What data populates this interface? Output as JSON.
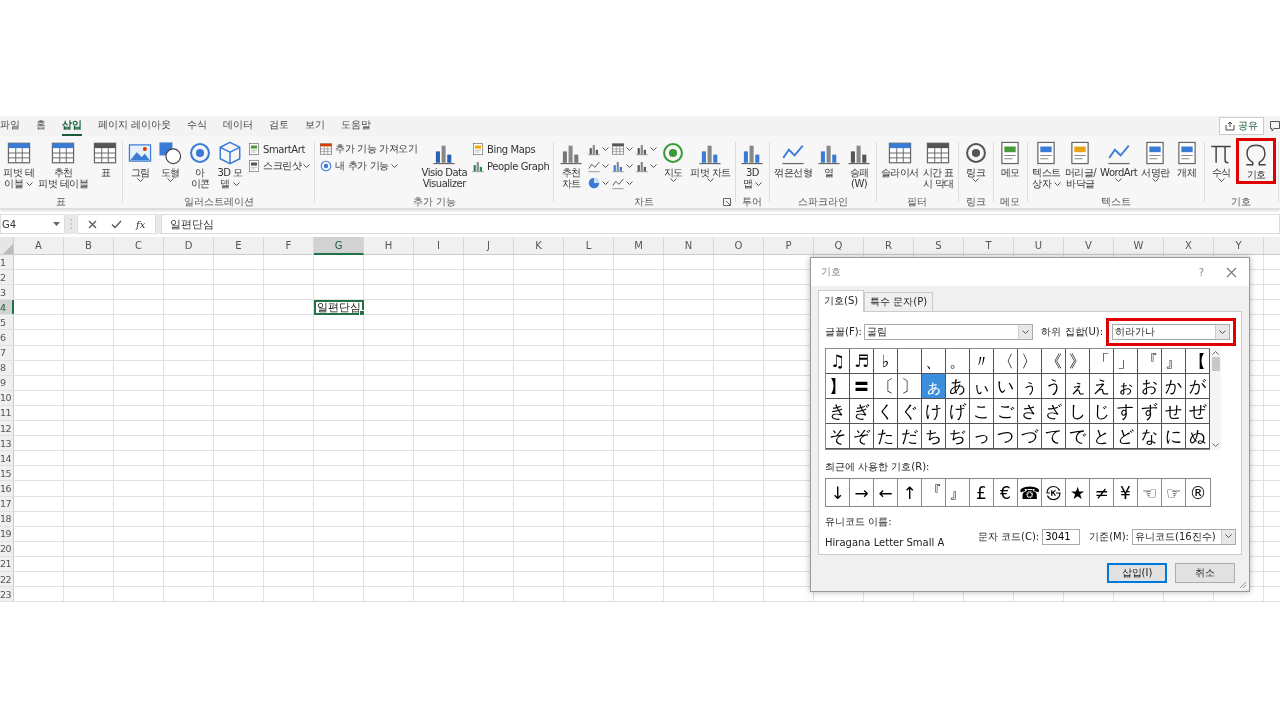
{
  "tabs": [
    {
      "label": "파일",
      "selected": false
    },
    {
      "label": "홈",
      "selected": false
    },
    {
      "label": "삽입",
      "selected": true
    },
    {
      "label": "페이지 레이아웃",
      "selected": false
    },
    {
      "label": "수식",
      "selected": false
    },
    {
      "label": "데이터",
      "selected": false
    },
    {
      "label": "검토",
      "selected": false
    },
    {
      "label": "보기",
      "selected": false
    },
    {
      "label": "도움말",
      "selected": false
    }
  ],
  "share_button": {
    "label": "공유"
  },
  "ribbon": {
    "groups": [
      {
        "label": "표",
        "launcher": false,
        "items": [
          {
            "kind": "large",
            "lines": [
              "피벗 테",
              "이블"
            ],
            "dropdown": true,
            "highlighted": false
          },
          {
            "kind": "large",
            "lines": [
              "추천",
              "피벗 테이블"
            ],
            "dropdown": false,
            "highlighted": false
          },
          {
            "kind": "large",
            "lines": [
              "표"
            ],
            "dropdown": false,
            "highlighted": false
          }
        ]
      },
      {
        "label": "일러스트레이션",
        "launcher": false,
        "items": [
          {
            "kind": "large",
            "lines": [
              "그림"
            ],
            "dropdown": true,
            "highlighted": false
          },
          {
            "kind": "large",
            "lines": [
              "도형"
            ],
            "dropdown": true,
            "highlighted": false
          },
          {
            "kind": "large",
            "lines": [
              "아",
              "이콘"
            ],
            "dropdown": false,
            "highlighted": false
          },
          {
            "kind": "large",
            "lines": [
              "3D 모",
              "델"
            ],
            "dropdown": true,
            "highlighted": false
          },
          {
            "kind": "stack",
            "items": [
              {
                "kind": "small",
                "label": "SmartArt",
                "dropdown": false
              },
              {
                "kind": "small",
                "label": "스크린샷",
                "dropdown": true
              }
            ]
          }
        ]
      },
      {
        "label": "추가 기능",
        "launcher": false,
        "items": [
          {
            "kind": "stack",
            "items": [
              {
                "kind": "small",
                "label": "추가 기능 가져오기",
                "dropdown": false
              },
              {
                "kind": "small",
                "label": "내 추가 기능",
                "dropdown": true
              }
            ]
          },
          {
            "kind": "large",
            "lines": [
              "Visio Data",
              "Visualizer"
            ],
            "dropdown": false,
            "highlighted": false
          },
          {
            "kind": "stack",
            "items": [
              {
                "kind": "small",
                "label": "Bing Maps",
                "dropdown": false
              },
              {
                "kind": "small",
                "label": "People Graph",
                "dropdown": false
              }
            ]
          }
        ]
      },
      {
        "label": "차트",
        "launcher": true,
        "items": [
          {
            "kind": "large",
            "lines": [
              "추천",
              "차트"
            ],
            "dropdown": false,
            "highlighted": false
          },
          {
            "kind": "stack",
            "items": [
              {
                "kind": "mini",
                "dropdown": true
              },
              {
                "kind": "mini",
                "dropdown": true
              },
              {
                "kind": "mini",
                "dropdown": true
              }
            ]
          },
          {
            "kind": "stack",
            "items": [
              {
                "kind": "mini",
                "dropdown": true
              },
              {
                "kind": "mini",
                "dropdown": true
              },
              {
                "kind": "mini",
                "dropdown": true
              }
            ]
          },
          {
            "kind": "stack",
            "items": [
              {
                "kind": "mini",
                "dropdown": true
              },
              {
                "kind": "mini",
                "dropdown": true
              }
            ]
          },
          {
            "kind": "large",
            "lines": [
              "지도"
            ],
            "dropdown": true,
            "highlighted": false
          },
          {
            "kind": "large",
            "lines": [
              "피벗 차트"
            ],
            "dropdown": true,
            "highlighted": false
          }
        ]
      },
      {
        "label": "투어",
        "launcher": false,
        "items": [
          {
            "kind": "large",
            "lines": [
              "3D",
              "맵"
            ],
            "dropdown": true,
            "highlighted": false
          }
        ]
      },
      {
        "label": "스파크라인",
        "launcher": false,
        "items": [
          {
            "kind": "large",
            "lines": [
              "꺾은선형"
            ],
            "dropdown": false,
            "highlighted": false
          },
          {
            "kind": "large",
            "lines": [
              "열"
            ],
            "dropdown": false,
            "highlighted": false
          },
          {
            "kind": "large",
            "lines": [
              "승패",
              "(W)"
            ],
            "dropdown": false,
            "highlighted": false
          }
        ]
      },
      {
        "label": "필터",
        "launcher": false,
        "items": [
          {
            "kind": "large",
            "lines": [
              "슬라이서"
            ],
            "dropdown": false,
            "highlighted": false
          },
          {
            "kind": "large",
            "lines": [
              "시간 표",
              "시 막대"
            ],
            "dropdown": false,
            "highlighted": false
          }
        ]
      },
      {
        "label": "링크",
        "launcher": false,
        "items": [
          {
            "kind": "large",
            "lines": [
              "링크"
            ],
            "dropdown": true,
            "highlighted": false
          }
        ]
      },
      {
        "label": "메모",
        "launcher": false,
        "items": [
          {
            "kind": "large",
            "lines": [
              "메모"
            ],
            "dropdown": false,
            "highlighted": false
          }
        ]
      },
      {
        "label": "텍스트",
        "launcher": false,
        "items": [
          {
            "kind": "large",
            "lines": [
              "텍스트",
              "상자"
            ],
            "dropdown": true,
            "highlighted": false
          },
          {
            "kind": "large",
            "lines": [
              "머리글/",
              "바닥글"
            ],
            "dropdown": false,
            "highlighted": false
          },
          {
            "kind": "large",
            "lines": [
              "WordArt"
            ],
            "dropdown": true,
            "highlighted": false
          },
          {
            "kind": "large",
            "lines": [
              "서명란"
            ],
            "dropdown": true,
            "highlighted": false
          },
          {
            "kind": "large",
            "lines": [
              "개체"
            ],
            "dropdown": false,
            "highlighted": false
          }
        ]
      },
      {
        "label": "기호",
        "launcher": false,
        "items": [
          {
            "kind": "large",
            "lines": [
              "수식"
            ],
            "dropdown": true,
            "highlighted": false
          },
          {
            "kind": "large",
            "lines": [
              "기호"
            ],
            "dropdown": false,
            "highlighted": true
          }
        ]
      }
    ]
  },
  "formula_bar": {
    "name_box": "G4",
    "fx": "fx",
    "content": "일편단심"
  },
  "sheet": {
    "columns": [
      {
        "label": "A",
        "selected": false
      },
      {
        "label": "B",
        "selected": false
      },
      {
        "label": "C",
        "selected": false
      },
      {
        "label": "D",
        "selected": false
      },
      {
        "label": "E",
        "selected": false
      },
      {
        "label": "F",
        "selected": false
      },
      {
        "label": "G",
        "selected": true
      },
      {
        "label": "H",
        "selected": false
      },
      {
        "label": "I",
        "selected": false
      },
      {
        "label": "J",
        "selected": false
      },
      {
        "label": "K",
        "selected": false
      },
      {
        "label": "L",
        "selected": false
      },
      {
        "label": "M",
        "selected": false
      },
      {
        "label": "N",
        "selected": false
      },
      {
        "label": "O",
        "selected": false
      },
      {
        "label": "P",
        "selected": false
      },
      {
        "label": "Q",
        "selected": false
      },
      {
        "label": "R",
        "selected": false
      },
      {
        "label": "S",
        "selected": false
      },
      {
        "label": "T",
        "selected": false
      },
      {
        "label": "U",
        "selected": false
      },
      {
        "label": "V",
        "selected": false
      },
      {
        "label": "W",
        "selected": false
      },
      {
        "label": "X",
        "selected": false
      },
      {
        "label": "Y",
        "selected": false
      }
    ],
    "rows": [
      {
        "label": "1",
        "selected": false
      },
      {
        "label": "2",
        "selected": false
      },
      {
        "label": "3",
        "selected": false
      },
      {
        "label": "4",
        "selected": true
      },
      {
        "label": "5",
        "selected": false
      },
      {
        "label": "6",
        "selected": false
      },
      {
        "label": "7",
        "selected": false
      },
      {
        "label": "8",
        "selected": false
      },
      {
        "label": "9",
        "selected": false
      },
      {
        "label": "10",
        "selected": false
      },
      {
        "label": "11",
        "selected": false
      },
      {
        "label": "12",
        "selected": false
      },
      {
        "label": "13",
        "selected": false
      },
      {
        "label": "14",
        "selected": false
      },
      {
        "label": "15",
        "selected": false
      },
      {
        "label": "16",
        "selected": false
      },
      {
        "label": "17",
        "selected": false
      },
      {
        "label": "18",
        "selected": false
      },
      {
        "label": "19",
        "selected": false
      },
      {
        "label": "20",
        "selected": false
      },
      {
        "label": "21",
        "selected": false
      },
      {
        "label": "22",
        "selected": false
      },
      {
        "label": "23",
        "selected": false
      }
    ],
    "active_cell_text": "일편단심"
  },
  "dialog": {
    "title": "기호",
    "help": "?",
    "tabs": [
      {
        "label": "기호(S)",
        "selected": true
      },
      {
        "label": "특수 문자(P)",
        "selected": false
      }
    ],
    "font_label": "글꼴(F):",
    "font": "굴림",
    "subset_label": "하위 집합(U):",
    "subset": "히라가나",
    "subset_highlighted": true,
    "symbols": [
      {
        "kind": "glyph",
        "char": "♫",
        "selected": false
      },
      {
        "kind": "glyph",
        "char": "♬",
        "selected": false
      },
      {
        "kind": "glyph",
        "char": "♭",
        "selected": false
      },
      {
        "kind": "blank",
        "selected": false
      },
      {
        "kind": "glyph",
        "char": "、",
        "selected": false
      },
      {
        "kind": "glyph",
        "char": "。",
        "selected": false
      },
      {
        "kind": "glyph",
        "char": "〃",
        "selected": false
      },
      {
        "kind": "glyph",
        "char": "〈",
        "selected": false
      },
      {
        "kind": "glyph",
        "char": "〉",
        "selected": false
      },
      {
        "kind": "glyph",
        "char": "《",
        "selected": false
      },
      {
        "kind": "glyph",
        "char": "》",
        "selected": false
      },
      {
        "kind": "glyph",
        "char": "「",
        "selected": false
      },
      {
        "kind": "glyph",
        "char": "」",
        "selected": false
      },
      {
        "kind": "glyph",
        "char": "『",
        "selected": false
      },
      {
        "kind": "glyph",
        "char": "』",
        "selected": false
      },
      {
        "kind": "glyph",
        "char": "【",
        "selected": false
      },
      {
        "kind": "glyph",
        "char": "】",
        "selected": false
      },
      {
        "kind": "glyph",
        "char": "〓",
        "selected": false
      },
      {
        "kind": "glyph",
        "char": "〔",
        "selected": false
      },
      {
        "kind": "glyph",
        "char": "〕",
        "selected": false
      },
      {
        "kind": "glyph",
        "char": "ぁ",
        "selected": true
      },
      {
        "kind": "glyph",
        "char": "あ",
        "selected": false
      },
      {
        "kind": "glyph",
        "char": "ぃ",
        "selected": false
      },
      {
        "kind": "glyph",
        "char": "い",
        "selected": false
      },
      {
        "kind": "glyph",
        "char": "ぅ",
        "selected": false
      },
      {
        "kind": "glyph",
        "char": "う",
        "selected": false
      },
      {
        "kind": "glyph",
        "char": "ぇ",
        "selected": false
      },
      {
        "kind": "glyph",
        "char": "え",
        "selected": false
      },
      {
        "kind": "glyph",
        "char": "ぉ",
        "selected": false
      },
      {
        "kind": "glyph",
        "char": "お",
        "selected": false
      },
      {
        "kind": "glyph",
        "char": "か",
        "selected": false
      },
      {
        "kind": "glyph",
        "char": "が",
        "selected": false
      },
      {
        "kind": "glyph",
        "char": "き",
        "selected": false
      },
      {
        "kind": "glyph",
        "char": "ぎ",
        "selected": false
      },
      {
        "kind": "glyph",
        "char": "く",
        "selected": false
      },
      {
        "kind": "glyph",
        "char": "ぐ",
        "selected": false
      },
      {
        "kind": "glyph",
        "char": "け",
        "selected": false
      },
      {
        "kind": "glyph",
        "char": "げ",
        "selected": false
      },
      {
        "kind": "glyph",
        "char": "こ",
        "selected": false
      },
      {
        "kind": "glyph",
        "char": "ご",
        "selected": false
      },
      {
        "kind": "glyph",
        "char": "さ",
        "selected": false
      },
      {
        "kind": "glyph",
        "char": "ざ",
        "selected": false
      },
      {
        "kind": "glyph",
        "char": "し",
        "selected": false
      },
      {
        "kind": "glyph",
        "char": "じ",
        "selected": false
      },
      {
        "kind": "glyph",
        "char": "す",
        "selected": false
      },
      {
        "kind": "glyph",
        "char": "ず",
        "selected": false
      },
      {
        "kind": "glyph",
        "char": "せ",
        "selected": false
      },
      {
        "kind": "glyph",
        "char": "ぜ",
        "selected": false
      },
      {
        "kind": "glyph",
        "char": "そ",
        "selected": false
      },
      {
        "kind": "glyph",
        "char": "ぞ",
        "selected": false
      },
      {
        "kind": "glyph",
        "char": "た",
        "selected": false
      },
      {
        "kind": "glyph",
        "char": "だ",
        "selected": false
      },
      {
        "kind": "glyph",
        "char": "ち",
        "selected": false
      },
      {
        "kind": "glyph",
        "char": "ぢ",
        "selected": false
      },
      {
        "kind": "glyph",
        "char": "っ",
        "selected": false
      },
      {
        "kind": "glyph",
        "char": "つ",
        "selected": false
      },
      {
        "kind": "glyph",
        "char": "づ",
        "selected": false
      },
      {
        "kind": "glyph",
        "char": "て",
        "selected": false
      },
      {
        "kind": "glyph",
        "char": "で",
        "selected": false
      },
      {
        "kind": "glyph",
        "char": "と",
        "selected": false
      },
      {
        "kind": "glyph",
        "char": "ど",
        "selected": false
      },
      {
        "kind": "glyph",
        "char": "な",
        "selected": false
      },
      {
        "kind": "glyph",
        "char": "に",
        "selected": false
      },
      {
        "kind": "glyph",
        "char": "ぬ",
        "selected": false
      }
    ],
    "recent_label": "최근에 사용한 기호(R):",
    "recent": [
      "↓",
      "→",
      "←",
      "↑",
      "『",
      "』",
      "£",
      "€",
      "☎",
      "㉿",
      "★",
      "≠",
      "¥",
      "☜",
      "☞",
      "®"
    ],
    "unicode_name_label": "유니코드 이름:",
    "unicode_name": "Hiragana Letter Small A",
    "code_label": "문자 코드(C):",
    "code": "3041",
    "basis_label": "기준(M):",
    "basis": "유니코드(16진수)",
    "insert_button": "삽입(I)",
    "cancel_button": "취소"
  }
}
